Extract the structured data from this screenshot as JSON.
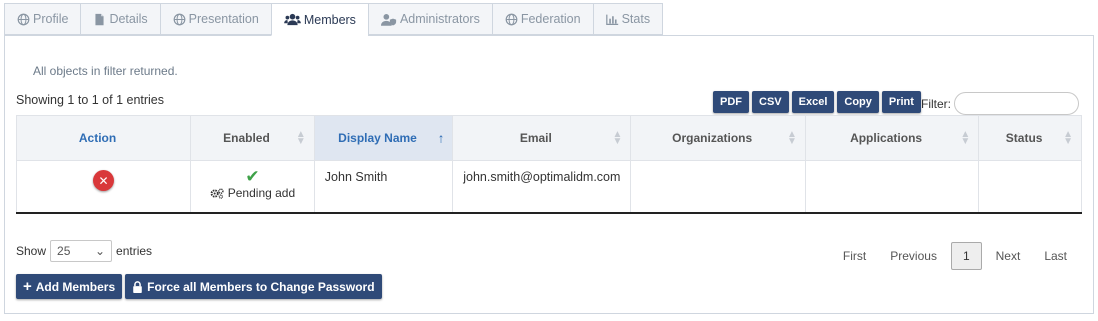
{
  "tabs": [
    {
      "label": "Profile",
      "icon": "globe-icon"
    },
    {
      "label": "Details",
      "icon": "document-icon"
    },
    {
      "label": "Presentation",
      "icon": "globe-icon"
    },
    {
      "label": "Members",
      "icon": "users-icon",
      "active": true
    },
    {
      "label": "Administrators",
      "icon": "user-shield-icon"
    },
    {
      "label": "Federation",
      "icon": "globe-icon"
    },
    {
      "label": "Stats",
      "icon": "bar-chart-icon"
    }
  ],
  "info_message": "All objects in filter returned.",
  "showing_text": "Showing 1 to 1 of 1 entries",
  "export_buttons": [
    "PDF",
    "CSV",
    "Excel",
    "Copy",
    "Print"
  ],
  "filter": {
    "label": "Filter:",
    "value": ""
  },
  "table": {
    "headers": [
      "Action",
      "Enabled",
      "Display Name",
      "Email",
      "Organizations",
      "Applications",
      "Status"
    ],
    "rows": [
      {
        "action": "delete",
        "enabled": "Pending add",
        "display_name": "John Smith",
        "email": "john.smith@optimalidm.com",
        "organizations": "",
        "applications": "",
        "status": ""
      }
    ]
  },
  "length": {
    "label_before": "Show",
    "value": "25",
    "label_after": "entries"
  },
  "pagination": {
    "first": "First",
    "previous": "Previous",
    "current": "1",
    "next": "Next",
    "last": "Last"
  },
  "buttons": {
    "add_members": "Add Members",
    "force_password": "Force all Members to Change Password"
  },
  "colors": {
    "accent": "#2f4a78",
    "link": "#2f6db5",
    "danger": "#d9383a",
    "success": "#3ea148"
  }
}
